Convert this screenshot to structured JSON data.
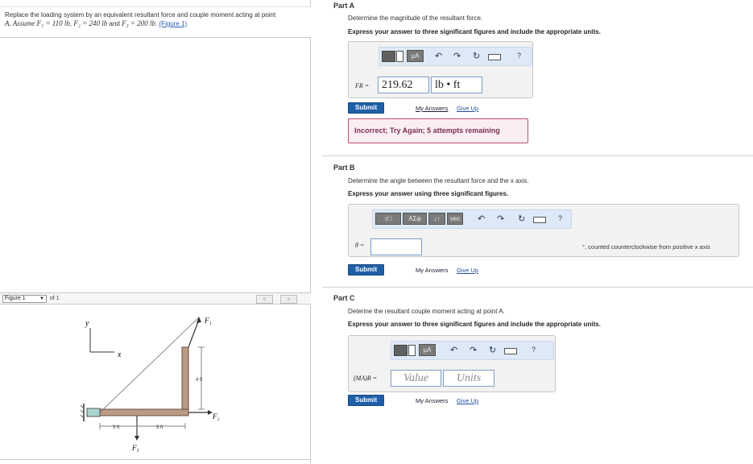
{
  "problem": {
    "line1": "Replace the loading system by an equivalent resultant force and couple moment acting at point",
    "line2_prefix": "A. Assume",
    "f1": "F₁ = 110 lb",
    "f2": "F₂ = 240 lb",
    "and": "and",
    "f3": "F₃ = 200 lb",
    "figure_link": "(Figure 1)"
  },
  "figure_bar": {
    "selected": "Figure 1",
    "of_label": "of 1",
    "prev": "<",
    "next": ">"
  },
  "figure": {
    "y_axis": "y",
    "x_axis": "x",
    "f1": "F₁",
    "f2": "F₂",
    "f3": "F₃",
    "dim_vertical": "4 ft",
    "dim_left": "3 ft",
    "dim_right": "3 ft"
  },
  "part_a": {
    "title": "Part A",
    "instruction": "Determine the magnitude of the resultant force.",
    "instruction_bold": "Express your answer to three significant figures and include the appropriate units.",
    "toolbar": {
      "mu": "μA",
      "help": "?"
    },
    "label": "FR =",
    "value": "219.62",
    "units": "lb • ft",
    "submit": "Submit",
    "my_answers": "My Answers",
    "give_up": "Give Up",
    "feedback": "Incorrect; Try Again; 5 attempts remaining"
  },
  "part_b": {
    "title": "Part B",
    "instruction": "Determine the angle between the resultant force and the x axis.",
    "instruction_bold": "Express your answer using three significant figures.",
    "toolbar": {
      "sqrt": "√□",
      "greek": "ΑΣφ",
      "arrows": "↓↑",
      "vec": "vec",
      "help": "?"
    },
    "label": "θ =",
    "value": "",
    "suffix": "°, counted counterclockwise from positive x axis",
    "submit": "Submit",
    "my_answers": "My Answers",
    "give_up": "Give Up"
  },
  "part_c": {
    "title": "Part C",
    "instruction": "Deterine the resultant couple moment acting at point A.",
    "instruction_bold": "Express your answer to three significant figures and include the appropriate units.",
    "toolbar": {
      "mu": "μA",
      "help": "?"
    },
    "label": "(MA)R =",
    "value_placeholder": "Value",
    "units_placeholder": "Units",
    "submit": "Submit",
    "my_answers": "My Answers",
    "give_up": "Give Up"
  }
}
